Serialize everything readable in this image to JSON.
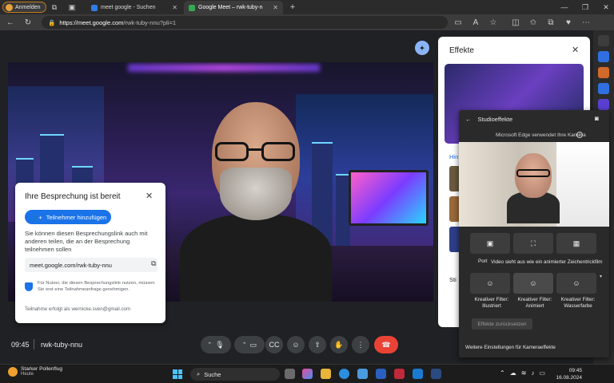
{
  "browser": {
    "profile_label": "Anmelden",
    "tabs": [
      {
        "title": "meet google - Suchen",
        "active": false
      },
      {
        "title": "Google Meet – rwk-tuby-n",
        "active": true
      }
    ],
    "new_tab": "+",
    "url_host": "https://meet.google.com",
    "url_path": "/rwk-tuby-nnu?pli=1"
  },
  "dialog": {
    "title": "Ihre Besprechung ist bereit",
    "add_button": "Teilnehmer hinzufügen",
    "description": "Sie können diesen Besprechungslink auch mit anderen teilen, die an der Besprechung teilnehmen sollen",
    "link": "meet.google.com/rwk-tuby-nnu",
    "note": "Für Nutzer, die diesen Besprechungslink nutzen, müssen Sie erst eine Teilnahmeanfrage genehmigen.",
    "joined_as": "Teilnahme erfolgt als wernicke.sven@gmail.com"
  },
  "meeting": {
    "time": "09:45",
    "code": "rwk-tuby-nnu"
  },
  "effects": {
    "title": "Effekte",
    "backgrounds_label": "Hin",
    "styles_label": "Sti"
  },
  "studio": {
    "title": "Studioeffekte",
    "camera_notice": "Microsoft Edge verwendet Ihre Kamera",
    "port_label": "Port",
    "tooltip": "Video sieht aus wie ein animierter Zeichentrickfilm",
    "filters": [
      {
        "label": "Kreativer Filter: Illustriert"
      },
      {
        "label": "Kreativer Filter: Animiert"
      },
      {
        "label": "Kreativer Filter: Wasserfarbe"
      }
    ],
    "reset": "Effekte zurücksetzen",
    "more_settings": "Weitere Einstellungen für Kameraeffekte"
  },
  "taskbar": {
    "weather_title": "Starker Pollenflug",
    "weather_sub": "Heute",
    "weather_badge": "1",
    "search_placeholder": "Suche",
    "clock_time": "09:45",
    "clock_date": "16.08.2024"
  },
  "colors": {
    "meet_bg": "#202124",
    "accent_blue": "#1a73e8",
    "end_call_red": "#ea4335",
    "panel_dark": "#2a2a2a"
  }
}
